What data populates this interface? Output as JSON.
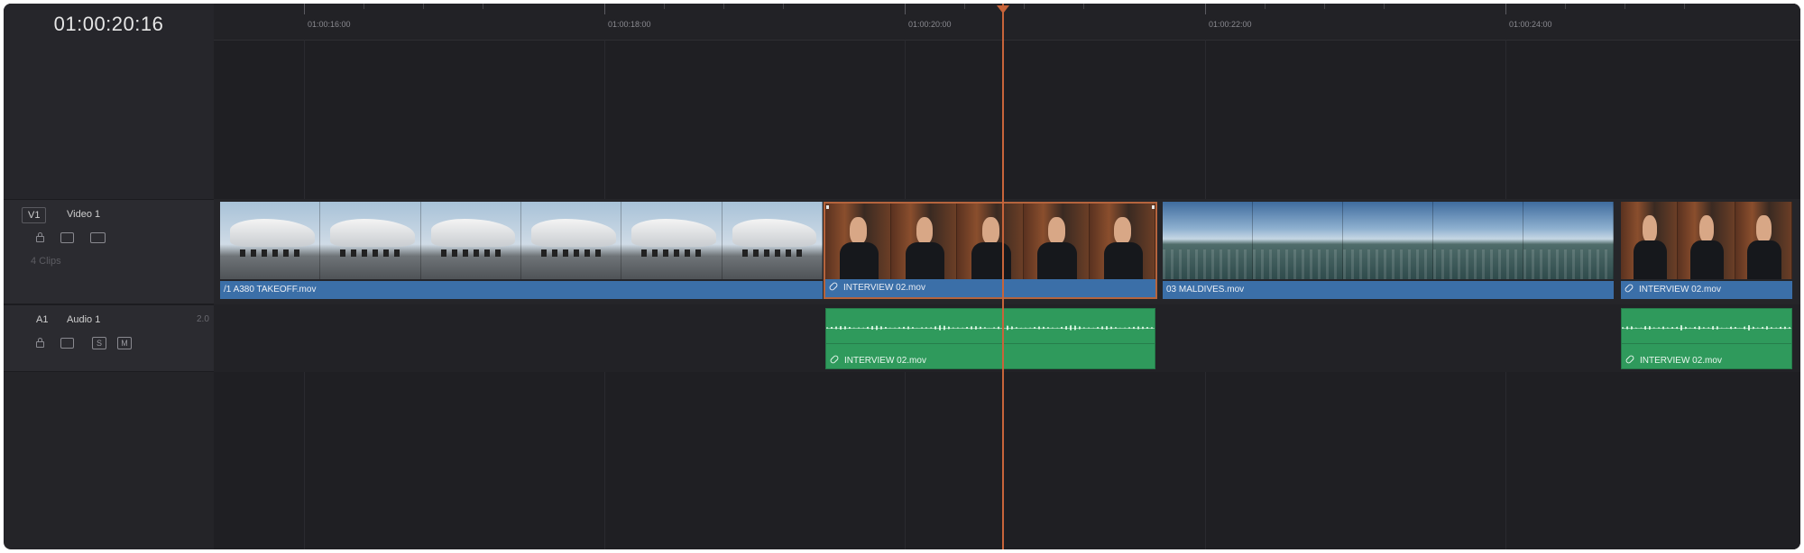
{
  "timecode": "01:00:20:16",
  "ruler": {
    "labels": [
      "01:00:16:00",
      "01:00:18:00",
      "01:00:20:00",
      "01:00:22:00",
      "01:00:24:00"
    ]
  },
  "tracks": {
    "video": {
      "badge": "V1",
      "name": "Video 1",
      "clip_count": "4 Clips"
    },
    "audio": {
      "badge": "A1",
      "name": "Audio 1",
      "format": "2.0",
      "solo_label": "S",
      "mute_label": "M"
    }
  },
  "clips": {
    "video": [
      {
        "label": "/1 A380 TAKEOFF.mov",
        "kind": "plane"
      },
      {
        "label": "INTERVIEW 02.mov",
        "kind": "interview",
        "linked": true
      },
      {
        "label": "03 MALDIVES.mov",
        "kind": "maldives"
      },
      {
        "label": "INTERVIEW 02.mov",
        "kind": "interview",
        "linked": true
      }
    ],
    "audio": [
      {
        "label": "INTERVIEW 02.mov",
        "linked": true
      },
      {
        "label": "INTERVIEW 02.mov",
        "linked": true
      }
    ]
  },
  "colors": {
    "playhead": "#c8643a",
    "video_clip_label": "#3b6fa8",
    "audio_clip": "#2f9a5c",
    "selected_clip_border": "#b5643d"
  },
  "icons": {
    "lock": "lock-icon",
    "video_eye": "video-monitor-icon",
    "video_screen": "screen-icon",
    "audio_monitor": "audio-monitor-icon",
    "link": "link-icon"
  }
}
